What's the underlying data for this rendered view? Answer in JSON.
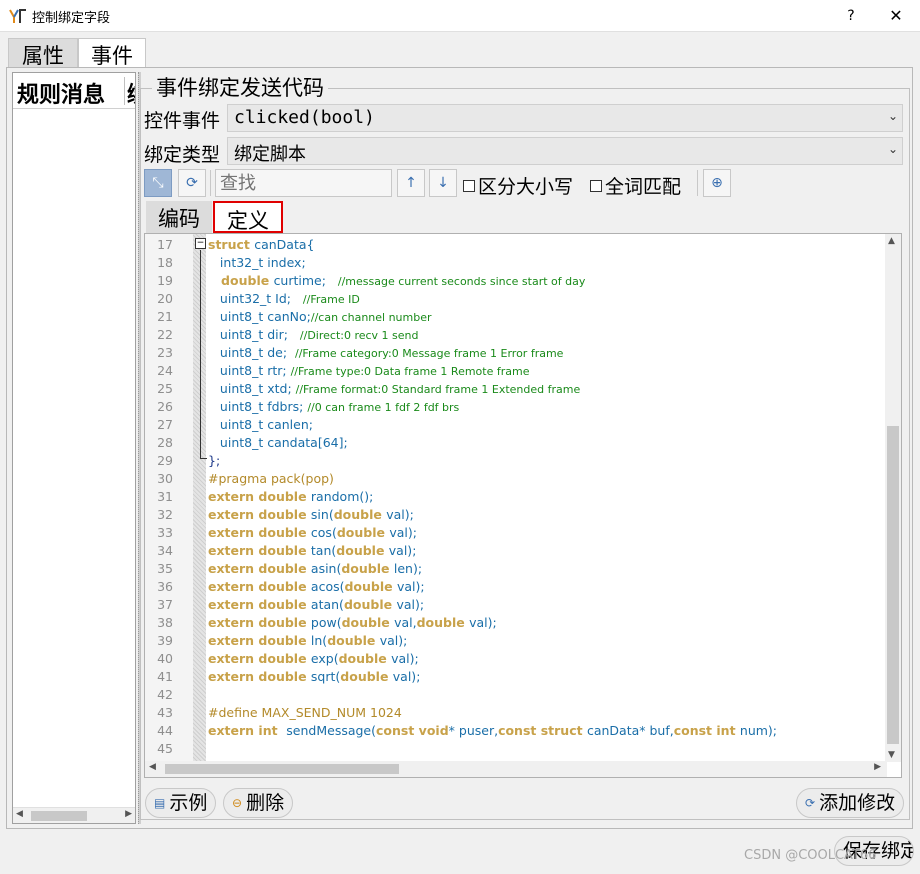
{
  "window": {
    "title": "控制绑定字段",
    "help": "?",
    "close": "✕"
  },
  "main_tabs": [
    "属性",
    "事件"
  ],
  "left_list": {
    "col1": "规则消息",
    "col2": "绑"
  },
  "group": {
    "title": "事件绑定发送代码",
    "event_label": "控件事件",
    "event_value": "clicked(bool)",
    "bind_label": "绑定类型",
    "bind_value": "绑定脚本"
  },
  "toolbar": {
    "find_placeholder": "查找",
    "case_label": "区分大小写",
    "word_label": "全词匹配"
  },
  "sub_tabs": [
    "编码",
    "定义"
  ],
  "code": {
    "line_numbers": [
      "17",
      "18",
      "19",
      "20",
      "21",
      "22",
      "23",
      "24",
      "25",
      "26",
      "27",
      "28",
      "29",
      "30",
      "31",
      "32",
      "33",
      "34",
      "35",
      "36",
      "37",
      "38",
      "39",
      "40",
      "41",
      "42",
      "43",
      "44",
      "45"
    ],
    "lines": [
      [
        {
          "t": "struct ",
          "c": "kw"
        },
        {
          "t": "canData{",
          "c": "ty"
        }
      ],
      [
        {
          "t": "   int32_t index;",
          "c": "ty"
        }
      ],
      [
        {
          "t": "   double ",
          "c": "kw"
        },
        {
          "t": "curtime;   ",
          "c": "ty"
        },
        {
          "t": "//message current seconds since start of day",
          "c": "cm"
        }
      ],
      [
        {
          "t": "   uint32_t Id;   ",
          "c": "ty"
        },
        {
          "t": "//Frame ID",
          "c": "cm"
        }
      ],
      [
        {
          "t": "   uint8_t canNo;",
          "c": "ty"
        },
        {
          "t": "//can channel number",
          "c": "cm"
        }
      ],
      [
        {
          "t": "   uint8_t dir;   ",
          "c": "ty"
        },
        {
          "t": "//Direct:0 recv 1 send",
          "c": "cm"
        }
      ],
      [
        {
          "t": "   uint8_t de;  ",
          "c": "ty"
        },
        {
          "t": "//Frame category:0 Message frame 1 Error frame",
          "c": "cm"
        }
      ],
      [
        {
          "t": "   uint8_t rtr; ",
          "c": "ty"
        },
        {
          "t": "//Frame type:0 Data frame 1 Remote frame",
          "c": "cm"
        }
      ],
      [
        {
          "t": "   uint8_t xtd; ",
          "c": "ty"
        },
        {
          "t": "//Frame format:0 Standard frame 1 Extended frame",
          "c": "cm"
        }
      ],
      [
        {
          "t": "   uint8_t fdbrs; ",
          "c": "ty"
        },
        {
          "t": "//0 can frame 1 fdf 2 fdf brs",
          "c": "cm"
        }
      ],
      [
        {
          "t": "   uint8_t canlen;",
          "c": "ty"
        }
      ],
      [
        {
          "t": "   uint8_t candata[64];",
          "c": "ty"
        }
      ],
      [
        {
          "t": "};",
          "c": ""
        }
      ],
      [
        {
          "t": "#pragma pack(pop)",
          "c": "pp"
        }
      ],
      [
        {
          "t": "extern double ",
          "c": "kw"
        },
        {
          "t": "random();",
          "c": "ty"
        }
      ],
      [
        {
          "t": "extern double ",
          "c": "kw"
        },
        {
          "t": "sin(",
          "c": "ty"
        },
        {
          "t": "double ",
          "c": "kw"
        },
        {
          "t": "val);",
          "c": "ty"
        }
      ],
      [
        {
          "t": "extern double ",
          "c": "kw"
        },
        {
          "t": "cos(",
          "c": "ty"
        },
        {
          "t": "double ",
          "c": "kw"
        },
        {
          "t": "val);",
          "c": "ty"
        }
      ],
      [
        {
          "t": "extern double ",
          "c": "kw"
        },
        {
          "t": "tan(",
          "c": "ty"
        },
        {
          "t": "double ",
          "c": "kw"
        },
        {
          "t": "val);",
          "c": "ty"
        }
      ],
      [
        {
          "t": "extern double ",
          "c": "kw"
        },
        {
          "t": "asin(",
          "c": "ty"
        },
        {
          "t": "double ",
          "c": "kw"
        },
        {
          "t": "len);",
          "c": "ty"
        }
      ],
      [
        {
          "t": "extern double ",
          "c": "kw"
        },
        {
          "t": "acos(",
          "c": "ty"
        },
        {
          "t": "double ",
          "c": "kw"
        },
        {
          "t": "val);",
          "c": "ty"
        }
      ],
      [
        {
          "t": "extern double ",
          "c": "kw"
        },
        {
          "t": "atan(",
          "c": "ty"
        },
        {
          "t": "double ",
          "c": "kw"
        },
        {
          "t": "val);",
          "c": "ty"
        }
      ],
      [
        {
          "t": "extern double ",
          "c": "kw"
        },
        {
          "t": "pow(",
          "c": "ty"
        },
        {
          "t": "double ",
          "c": "kw"
        },
        {
          "t": "val,",
          "c": "ty"
        },
        {
          "t": "double ",
          "c": "kw"
        },
        {
          "t": "val);",
          "c": "ty"
        }
      ],
      [
        {
          "t": "extern double ",
          "c": "kw"
        },
        {
          "t": "ln(",
          "c": "ty"
        },
        {
          "t": "double ",
          "c": "kw"
        },
        {
          "t": "val);",
          "c": "ty"
        }
      ],
      [
        {
          "t": "extern double ",
          "c": "kw"
        },
        {
          "t": "exp(",
          "c": "ty"
        },
        {
          "t": "double ",
          "c": "kw"
        },
        {
          "t": "val);",
          "c": "ty"
        }
      ],
      [
        {
          "t": "extern double ",
          "c": "kw"
        },
        {
          "t": "sqrt(",
          "c": "ty"
        },
        {
          "t": "double ",
          "c": "kw"
        },
        {
          "t": "val);",
          "c": "ty"
        }
      ],
      [
        {
          "t": "",
          "c": ""
        }
      ],
      [
        {
          "t": "#define MAX_SEND_NUM 1024",
          "c": "pp"
        }
      ],
      [
        {
          "t": "extern int  ",
          "c": "kw"
        },
        {
          "t": "sendMessage(",
          "c": "ty"
        },
        {
          "t": "const void",
          "c": "kw"
        },
        {
          "t": "* puser,",
          "c": "ty"
        },
        {
          "t": "const struct ",
          "c": "kw"
        },
        {
          "t": "canData* buf,",
          "c": "ty"
        },
        {
          "t": "const int ",
          "c": "kw"
        },
        {
          "t": "num);",
          "c": "ty"
        }
      ],
      [
        {
          "t": "",
          "c": ""
        }
      ]
    ]
  },
  "buttons": {
    "example": "示例",
    "delete": "删除",
    "add_modify": "添加修改",
    "save_bind": "保存绑定"
  },
  "watermark": "CSDN @COOLCAT66"
}
